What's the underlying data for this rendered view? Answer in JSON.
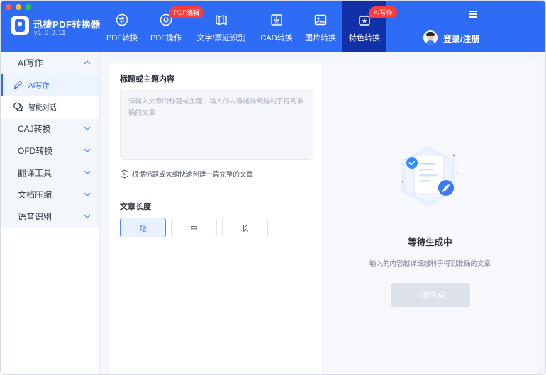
{
  "app": {
    "name": "迅捷PDF转换器",
    "version": "v1.0.0.11"
  },
  "nav": {
    "items": [
      {
        "label": "PDF转换",
        "icon": "pdf-convert-icon"
      },
      {
        "label": "PDF操作",
        "icon": "pdf-operate-icon",
        "badge": "PDF编辑"
      },
      {
        "label": "文字/票证识别",
        "icon": "ocr-icon"
      },
      {
        "label": "CAD转换",
        "icon": "cad-icon"
      },
      {
        "label": "图片转换",
        "icon": "image-icon"
      },
      {
        "label": "特色转换",
        "icon": "feature-icon",
        "badge": "AI写作",
        "active": true
      }
    ],
    "login_label": "登录/注册"
  },
  "sidebar": {
    "groups": [
      {
        "label": "AI写作",
        "expanded": true
      },
      {
        "label": "CAJ转换"
      },
      {
        "label": "OFD转换"
      },
      {
        "label": "翻译工具"
      },
      {
        "label": "文档压缩"
      },
      {
        "label": "语音识别"
      }
    ],
    "sub_items": [
      {
        "label": "AI写作",
        "icon": "pen-icon",
        "active": true
      },
      {
        "label": "智能对话",
        "icon": "chat-icon"
      }
    ]
  },
  "form": {
    "title_label": "标题或主题内容",
    "placeholder": "请输入文章的标题或主题，输入的内容越详细越利于得到准确的文章",
    "tip": "根据标题或大纲快速创建一篇完整的文章",
    "length_label": "文章长度",
    "lengths": [
      {
        "label": "短",
        "active": true
      },
      {
        "label": "中"
      },
      {
        "label": "长"
      }
    ]
  },
  "result": {
    "title": "等待生成中",
    "subtitle": "输入的内容越详细越利于得到准确的文章",
    "button": "立即生成"
  },
  "colors": {
    "brand": "#2f6cf5",
    "nav_active": "#1231a8",
    "badge": "#ff3b3b"
  }
}
